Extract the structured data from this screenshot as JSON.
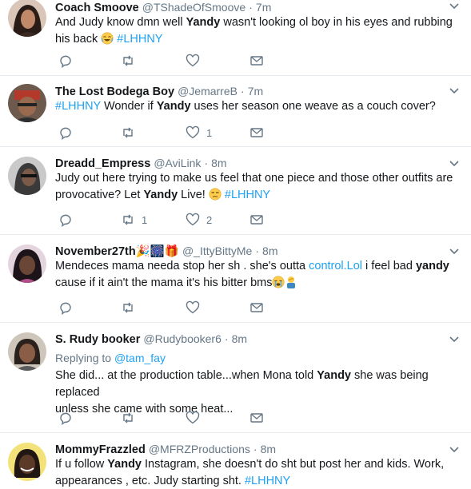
{
  "tweets": [
    {
      "name": "Coach Smoove",
      "handle": "@TShadeOfSmoove",
      "time": "7m",
      "lines": [
        {
          "segs": [
            {
              "t": "And Judy know d",
              "c": ""
            },
            {
              "t": "mn well ",
              "c": ""
            },
            {
              "t": "Yandy",
              "c": "hl"
            },
            {
              "t": " wasn't looking ol boy in his eyes and rubbing",
              "c": ""
            }
          ]
        },
        {
          "segs": [
            {
              "t": "his back ",
              "c": ""
            },
            {
              "t": "😂",
              "c": "emo:joy"
            },
            {
              "t": " ",
              "c": ""
            },
            {
              "t": "#LHHNY",
              "c": "tag"
            }
          ]
        }
      ],
      "retweets": "",
      "likes": ""
    },
    {
      "name": "The Lost Bodega Boy",
      "handle": "@JemarreB",
      "time": "7m",
      "lines": [
        {
          "segs": [
            {
              "t": "#LHHNY",
              "c": "tag"
            },
            {
              "t": " Wonder if ",
              "c": ""
            },
            {
              "t": "Yandy",
              "c": "hl"
            },
            {
              "t": " uses her season one weave as a couch cover?",
              "c": ""
            }
          ]
        }
      ],
      "retweets": "",
      "likes": "1"
    },
    {
      "name": "Dreadd_Empress",
      "handle": "@AviLink",
      "time": "8m",
      "lines": [
        {
          "segs": [
            {
              "t": "Judy out here trying to make us feel that one piece and those other outfits are",
              "c": ""
            }
          ]
        },
        {
          "segs": [
            {
              "t": "provocative? Let ",
              "c": ""
            },
            {
              "t": "Yandy",
              "c": "hl"
            },
            {
              "t": " Live! ",
              "c": ""
            },
            {
              "t": "😒",
              "c": "emo:unamused"
            },
            {
              "t": " ",
              "c": ""
            },
            {
              "t": "#LHHNY",
              "c": "tag"
            }
          ]
        }
      ],
      "retweets": "1",
      "likes": "2"
    },
    {
      "name": "November27th",
      "handle": "@_IttyBittyMe",
      "time": "8m",
      "lines": [
        {
          "segs": [
            {
              "t": "Mendeces mama needa stop her sh",
              "c": ""
            },
            {
              "t": " . she's outta ",
              "c": ""
            },
            {
              "t": "control.Lol",
              "c": "tag"
            },
            {
              "t": " i feel bad ",
              "c": ""
            },
            {
              "t": "yandy",
              "c": "hl"
            }
          ]
        },
        {
          "segs": [
            {
              "t": "cause if it ain't the mama it's his bitter bms",
              "c": ""
            },
            {
              "t": "😭",
              "c": "emo:sob"
            },
            {
              "t": "🤦",
              "c": "emo:facepalm"
            }
          ]
        }
      ],
      "retweets": "",
      "likes": ""
    },
    {
      "name": "S. Rudy booker",
      "handle": "@Rudybooker6",
      "time": "8m",
      "replying_label": "Replying to",
      "replying_handle": "@tam_fay",
      "lines": [
        {
          "segs": [
            {
              "t": "She did... at the production table...when Mona told ",
              "c": ""
            },
            {
              "t": "Yandy",
              "c": "hl"
            },
            {
              "t": " she was being replaced",
              "c": ""
            }
          ]
        },
        {
          "segs": [
            {
              "t": "unless she came with some heat...",
              "c": ""
            }
          ]
        }
      ],
      "retweets": "",
      "likes": ""
    },
    {
      "name": "MommyFrazzled",
      "handle": "@MFRZProductions",
      "time": "8m",
      "lines": [
        {
          "segs": [
            {
              "t": "If u follow ",
              "c": ""
            },
            {
              "t": "Yandy",
              "c": "hl"
            },
            {
              "t": " Instagram, she doesn't do sh",
              "c": ""
            },
            {
              "t": "t but post her and kids. Work,",
              "c": ""
            }
          ]
        },
        {
          "segs": [
            {
              "t": "appearances , etc. Judy starting sh",
              "c": ""
            },
            {
              "t": "t. ",
              "c": ""
            },
            {
              "t": "#LHHNY",
              "c": "tag"
            }
          ]
        }
      ],
      "retweets": "",
      "likes": ""
    }
  ],
  "colors": {
    "accent": "#1da1f2",
    "muted": "#657786",
    "text": "#14171a",
    "divider": "#e6ecf0"
  }
}
